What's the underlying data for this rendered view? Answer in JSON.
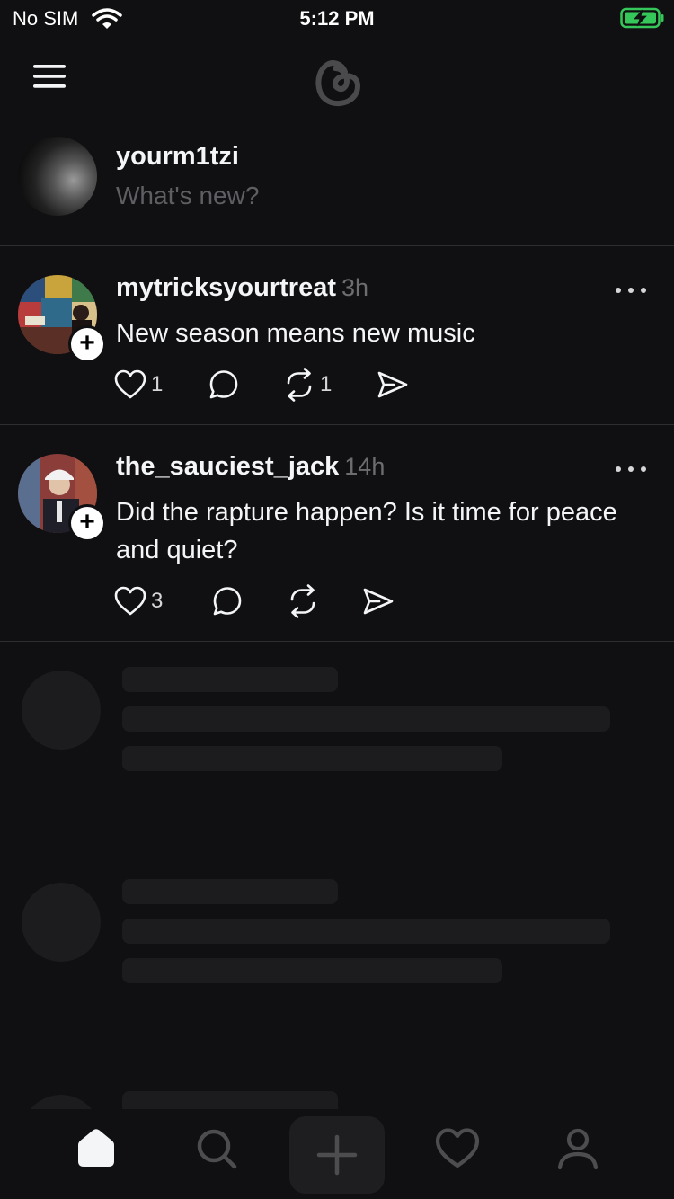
{
  "status_bar": {
    "carrier": "No SIM",
    "time": "5:12 PM"
  },
  "composer": {
    "username": "yourm1tzi",
    "placeholder": "What's new?"
  },
  "posts": [
    {
      "author": "mytricksyourtreat",
      "time": "3h",
      "text": "New season means new music",
      "likes": "1",
      "reposts": "1"
    },
    {
      "author": "the_sauciest_jack",
      "time": "14h",
      "text": "Did the rapture happen? Is it time for peace and quiet?",
      "likes": "3",
      "reposts": ""
    }
  ],
  "colors": {
    "background": "#101012",
    "text": "#f3f5f7",
    "muted": "#6d6d70",
    "skeleton": "#1c1c1e",
    "battery": "#35c759"
  },
  "icons": {
    "tabs": [
      "home-icon",
      "search-icon",
      "plus-icon",
      "heart-icon",
      "profile-icon"
    ],
    "actions": [
      "heart-icon",
      "comment-icon",
      "repost-icon",
      "share-icon"
    ]
  }
}
